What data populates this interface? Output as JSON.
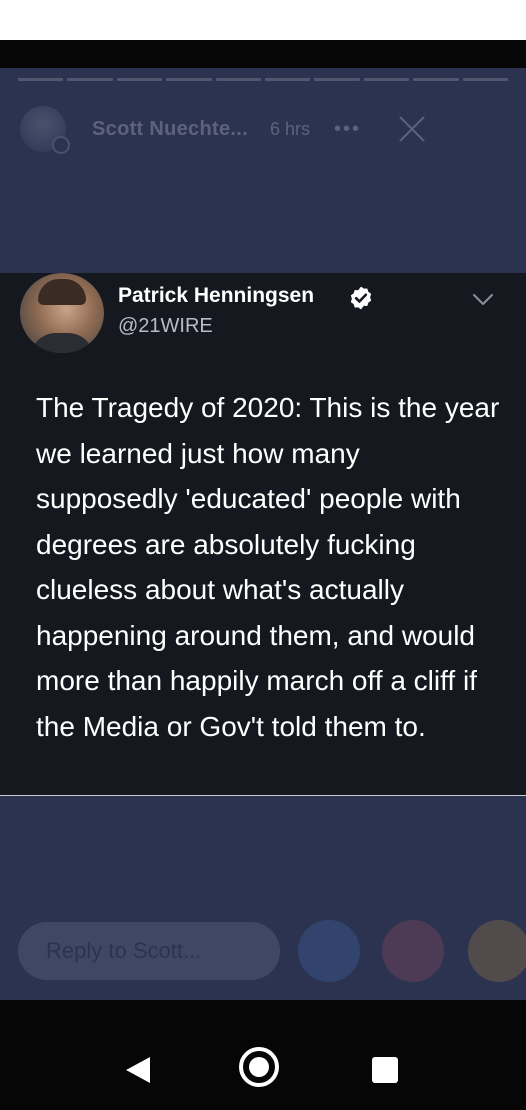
{
  "story": {
    "poster_name": "Scott Nuechte...",
    "time": "6 hrs",
    "more": "•••",
    "reply_placeholder": "Reply to Scott..."
  },
  "tweet": {
    "name": "Patrick Henningsen",
    "handle": "@21WIRE",
    "text": "The Tragedy of 2020: This is the year we learned just how many supposedly 'educated' people with degrees are absolutely fucking clueless about what's actually happening around them, and would more than happily march off a cliff if the Media or Gov't told them to."
  },
  "colors": {
    "story_background": "#2c3350",
    "tweet_background": "#15181f",
    "nav_background": "#060607"
  },
  "icons": {
    "verified": "verified-badge-icon",
    "menu": "chevron-down-icon",
    "nav": [
      "back-triangle-icon",
      "home-circle-icon",
      "recents-square-icon"
    ],
    "reactions": [
      "like-icon",
      "love-icon",
      "haha-icon"
    ]
  }
}
